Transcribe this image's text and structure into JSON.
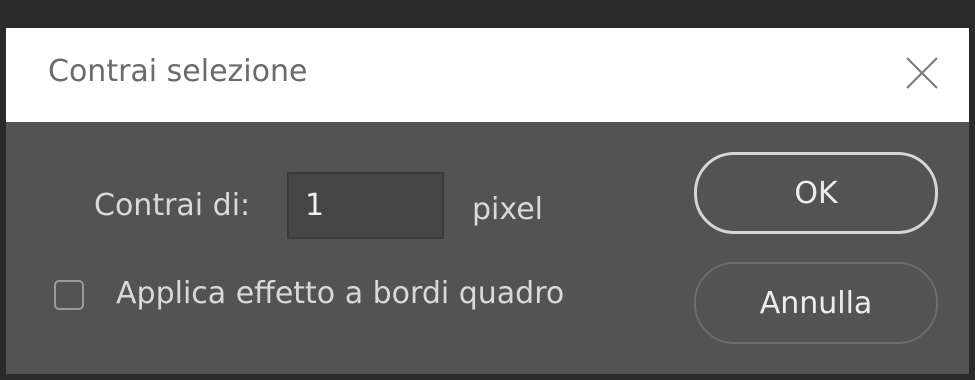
{
  "dialog": {
    "title": "Contrai selezione",
    "contract_label": "Contrai di:",
    "contract_value": "1",
    "unit": "pixel",
    "checkbox_label": "Applica effetto a bordi quadro",
    "checkbox_checked": false,
    "ok_label": "OK",
    "cancel_label": "Annulla",
    "close_icon": "close-icon"
  }
}
